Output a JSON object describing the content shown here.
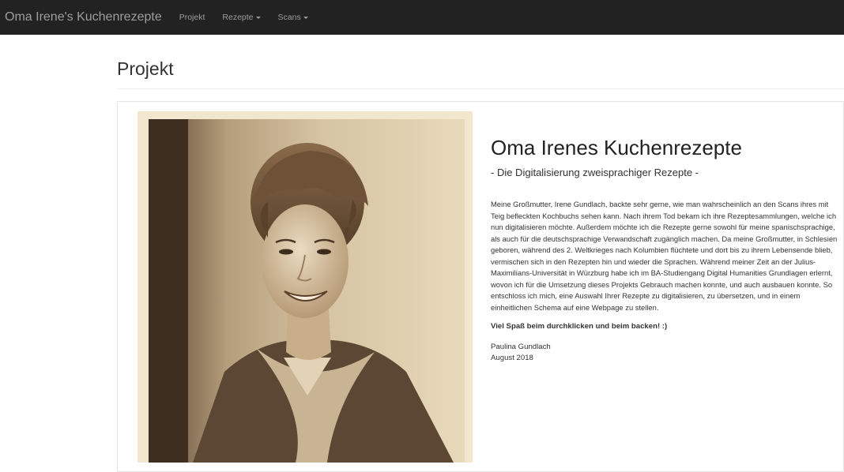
{
  "navbar": {
    "brand": "Oma Irene's Kuchenrezepte",
    "items": [
      {
        "label": "Projekt",
        "dropdown": false
      },
      {
        "label": "Rezepte",
        "dropdown": true
      },
      {
        "label": "Scans",
        "dropdown": true
      }
    ]
  },
  "page": {
    "title": "Projekt"
  },
  "content": {
    "heading": "Oma Irenes Kuchenrezepte",
    "subtitle": "- Die Digitalisierung zweisprachiger Rezepte -",
    "body": "Meine Großmutter, Irene Gundlach, backte sehr gerne, wie man wahrscheinlich an den Scans ihres mit Teig befleckten Kochbuchs sehen kann. Nach ihrem Tod bekam ich ihre Rezeptesammlungen, welche ich nun digitalisieren möchte. Außerdem möchte ich die Rezepte gerne sowohl für meine spanischsprachige, als auch für die deutschsprachige Verwandschaft zugänglich machen. Da meine Großmutter, in Schlesien geboren, während des 2. Weltkrieges nach Kolumbien flüchtete und dort bis zu ihrem Lebensende blieb, vermischen sich in den Rezepten hin und wieder die Sprachen. Während meiner Zeit an der Julius-Maximilians-Universität in Würzburg habe ich im BA-Studiengang Digital Humanities Grundlagen erlernt, wovon ich für die Umsetzung dieses Projekts Gebrauch machen konnte, und auch ausbauen konnte. So entschloss ich mich, eine Auswahl Ihrer Rezepte zu digitalisieren, zu übersetzen, und in einem einheitlichen Schema auf eine Webpage zu stellen.",
    "closing": "Viel Spaß beim durchklicken und beim backen! :)",
    "author": "Paulina Gundlach",
    "date": "August 2018"
  },
  "colors": {
    "navbar_bg": "#222222",
    "navbar_text": "#9d9d9d",
    "photo_paper": "#f1e7cf",
    "photo_sepia_dark": "#3a2a1c"
  },
  "icons": {
    "dropdown": "caret-down-icon"
  }
}
